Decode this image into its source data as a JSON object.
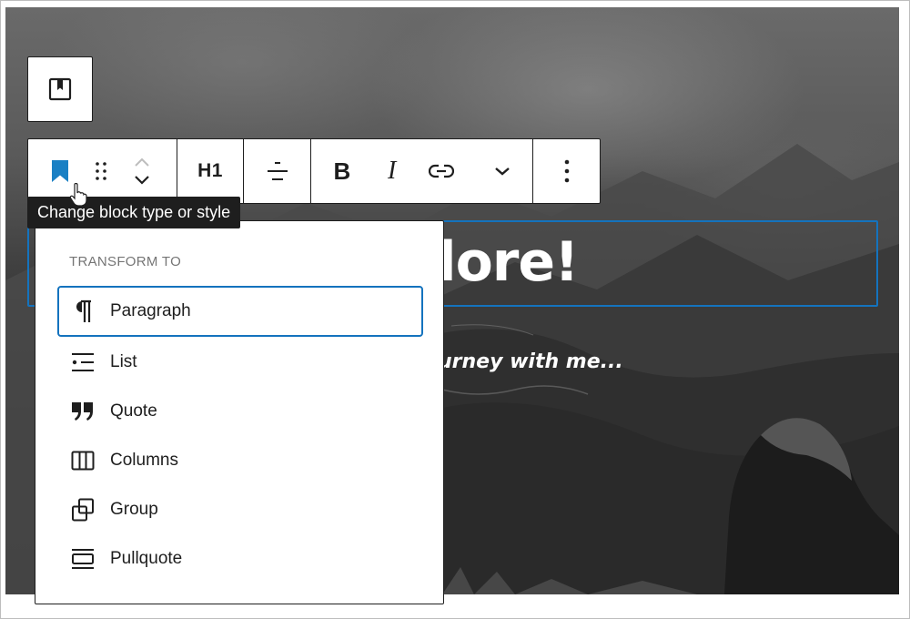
{
  "toolbar": {
    "heading_level": "H1",
    "bold_label": "B",
    "italic_label": "I"
  },
  "tooltip": {
    "text": "Change block type or style"
  },
  "content": {
    "heading_visible": "lore!",
    "subtitle_visible": "urney with me..."
  },
  "transform_menu": {
    "title": "TRANSFORM TO",
    "items": [
      {
        "label": "Paragraph",
        "icon": "paragraph-icon"
      },
      {
        "label": "List",
        "icon": "list-icon"
      },
      {
        "label": "Quote",
        "icon": "quote-icon"
      },
      {
        "label": "Columns",
        "icon": "columns-icon"
      },
      {
        "label": "Group",
        "icon": "group-icon"
      },
      {
        "label": "Pullquote",
        "icon": "pullquote-icon"
      }
    ]
  },
  "colors": {
    "accent": "#1473be",
    "block_icon": "#1a80c4",
    "tooltip_bg": "#1e1e1e",
    "text": "#1e1e1e"
  }
}
